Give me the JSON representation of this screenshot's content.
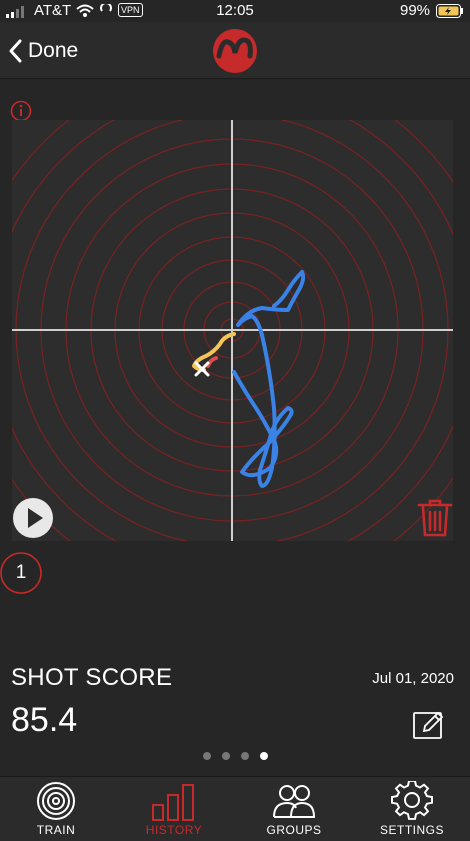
{
  "status_bar": {
    "carrier": "AT&T",
    "vpn": "VPN",
    "time": "12:05",
    "battery": "99%"
  },
  "nav": {
    "back_label": "Done"
  },
  "shot": {
    "number": "1",
    "score_label": "SHOT SCORE",
    "score": "85.4",
    "date": "Jul 01, 2020"
  },
  "pager": {
    "count": 4,
    "active_index": 3
  },
  "tabs": [
    {
      "label": "TRAIN",
      "icon": "target-icon",
      "active": false
    },
    {
      "label": "HISTORY",
      "icon": "bar-chart-icon",
      "active": true
    },
    {
      "label": "GROUPS",
      "icon": "people-icon",
      "active": false
    },
    {
      "label": "SETTINGS",
      "icon": "gear-icon",
      "active": false
    }
  ],
  "colors": {
    "accent": "#c62a2a",
    "background": "#262626",
    "trace_pre": "#f3c556",
    "trace_post": "#3b82e6",
    "rings": "#7a2222"
  }
}
